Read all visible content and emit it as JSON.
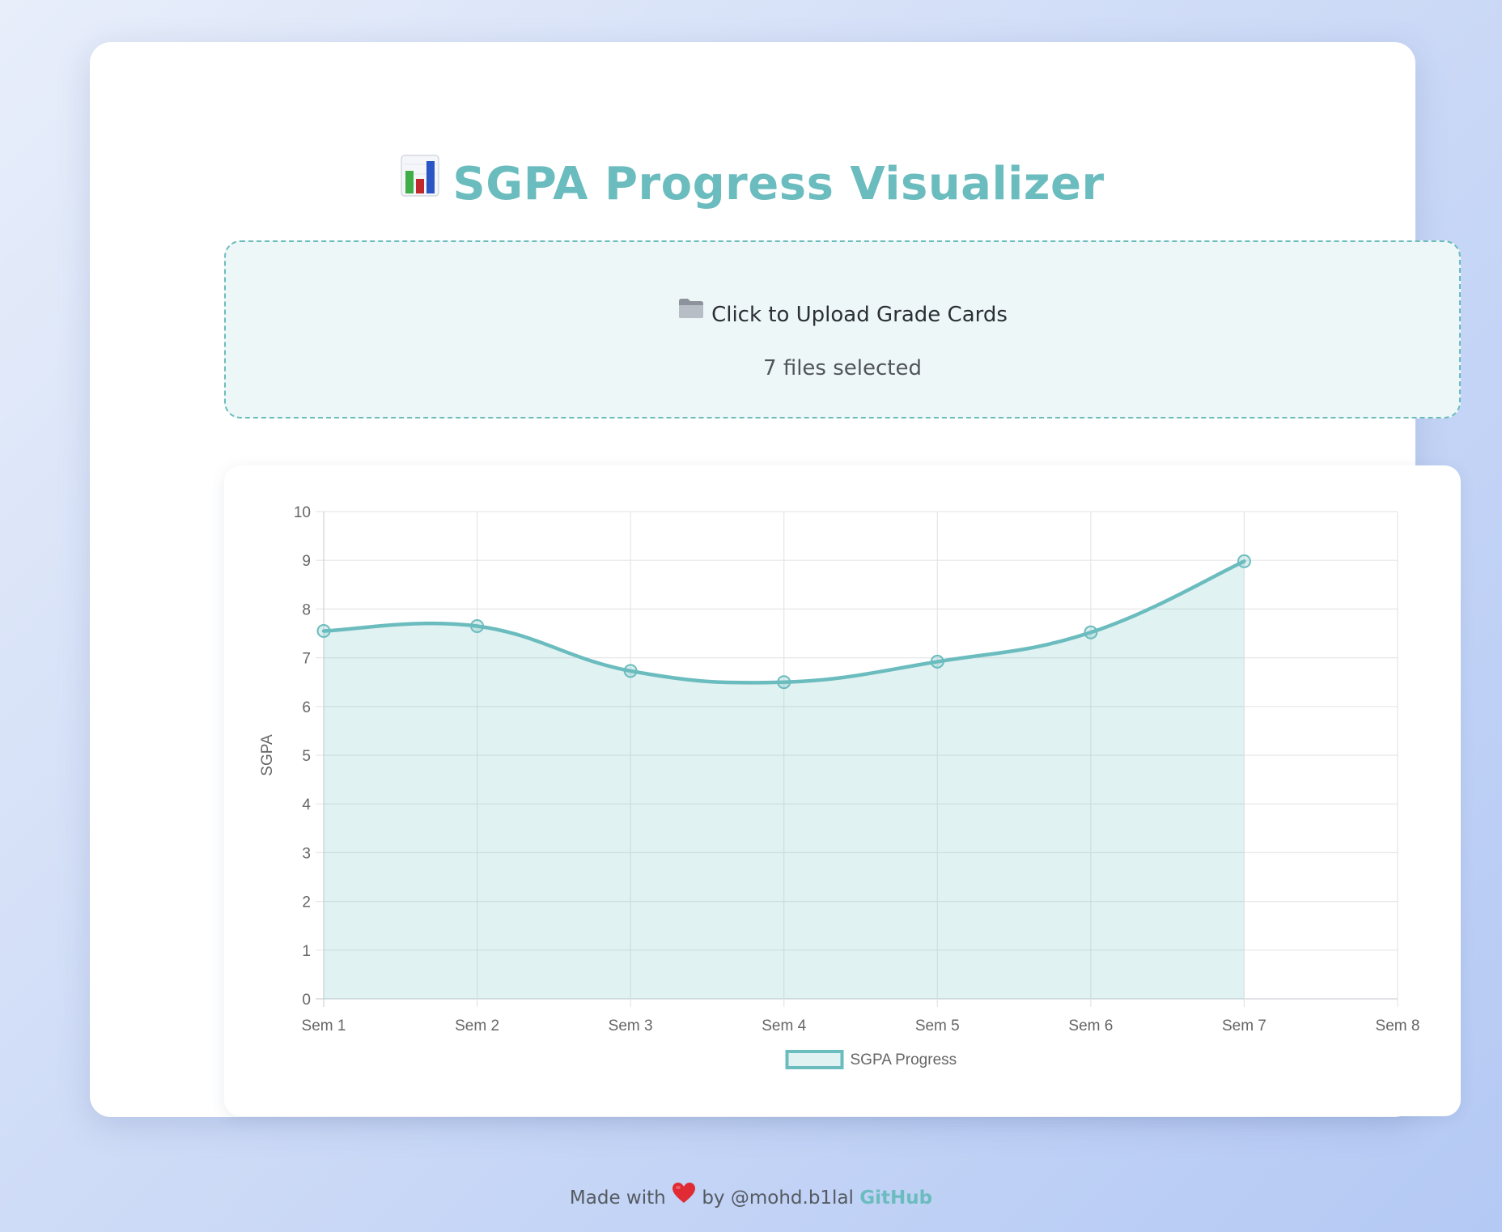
{
  "app": {
    "title": "SGPA Progress Visualizer"
  },
  "upload": {
    "label": "Click to Upload Grade Cards",
    "status": "7 files selected"
  },
  "chart_data": {
    "type": "line",
    "categories": [
      "Sem 1",
      "Sem 2",
      "Sem 3",
      "Sem 4",
      "Sem 5",
      "Sem 6",
      "Sem 7",
      "Sem 8"
    ],
    "series": [
      {
        "name": "SGPA Progress",
        "values": [
          7.55,
          7.65,
          6.73,
          6.5,
          6.92,
          7.52,
          8.98,
          null
        ],
        "color": "#6bbcbe",
        "fill": "rgba(107, 188, 190, 0.2)",
        "smooth": true,
        "filled": true
      }
    ],
    "title": "",
    "xlabel": "",
    "ylabel": "SGPA",
    "ylim": [
      0,
      10
    ],
    "yticks": [
      0,
      1,
      2,
      3,
      4,
      5,
      6,
      7,
      8,
      9,
      10
    ],
    "grid": true,
    "legend": "bottom"
  },
  "footer": {
    "prefix": "Made with",
    "by": "by @mohd.b1lal",
    "link": "GitHub"
  },
  "colors": {
    "accent": "#6bbcbe",
    "heart": "#e02b35"
  },
  "icons": {
    "title": "bar-chart-emoji-icon",
    "upload": "folder-icon",
    "footer": "heart-icon"
  }
}
